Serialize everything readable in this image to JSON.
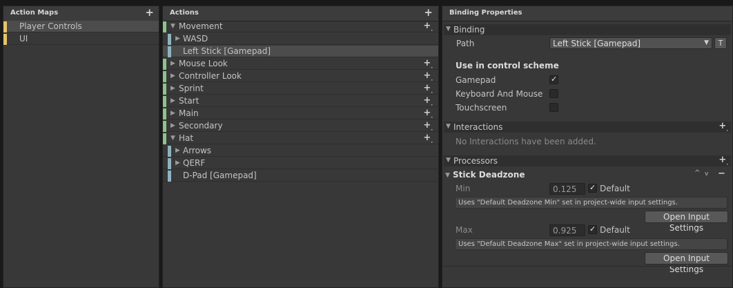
{
  "action_maps": {
    "title": "Action Maps",
    "add_icon": "+",
    "items": [
      {
        "label": "Player Controls",
        "selected": true
      },
      {
        "label": "UI",
        "selected": false
      }
    ]
  },
  "actions": {
    "title": "Actions",
    "add_icon": "+",
    "rows": [
      {
        "label": "Movement",
        "expanded": true
      },
      {
        "label": "WASD",
        "expanded": false
      },
      {
        "label": "Left Stick [Gamepad]"
      },
      {
        "label": "Mouse Look"
      },
      {
        "label": "Controller Look"
      },
      {
        "label": "Sprint"
      },
      {
        "label": "Start"
      },
      {
        "label": "Main"
      },
      {
        "label": "Secondary"
      },
      {
        "label": "Hat",
        "expanded": true
      },
      {
        "label": "Arrows"
      },
      {
        "label": "QERF"
      },
      {
        "label": "D-Pad [Gamepad]"
      }
    ]
  },
  "binding_properties": {
    "title": "Binding Properties",
    "binding": {
      "header": "Binding",
      "path_label": "Path",
      "path_value": "Left Stick [Gamepad]",
      "t_button": "T",
      "scheme_heading": "Use in control scheme",
      "schemes": [
        {
          "label": "Gamepad",
          "checked": true
        },
        {
          "label": "Keyboard And Mouse",
          "checked": false
        },
        {
          "label": "Touchscreen",
          "checked": false
        }
      ]
    },
    "interactions": {
      "header": "Interactions",
      "empty": "No Interactions have been added."
    },
    "processors": {
      "header": "Processors",
      "stick_deadzone": {
        "header": "Stick Deadzone",
        "min_label": "Min",
        "min_value": "0.125",
        "min_default": "Default",
        "min_help": "Uses \"Default Deadzone Min\" set in project-wide input settings.",
        "max_label": "Max",
        "max_value": "0.925",
        "max_default": "Default",
        "max_help": "Uses \"Default Deadzone Max\" set in project-wide input settings.",
        "open_button": "Open Input Settings"
      }
    }
  }
}
